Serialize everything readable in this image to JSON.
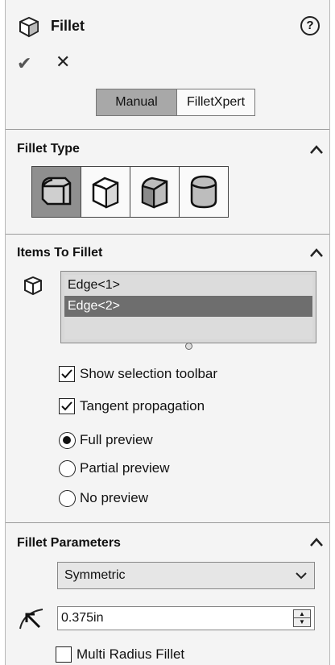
{
  "header": {
    "title": "Fillet",
    "help_icon": "help-icon"
  },
  "actions": {
    "ok_glyph": "✔",
    "cancel_glyph": "✕"
  },
  "modes": {
    "manual": "Manual",
    "filletxpert": "FilletXpert"
  },
  "fillet_type": {
    "heading": "Fillet Type",
    "buttons": [
      "constant-size-fillet-icon",
      "variable-size-fillet-icon",
      "face-fillet-icon",
      "full-round-fillet-icon"
    ],
    "selected_index": 0
  },
  "items": {
    "heading": "Items To Fillet",
    "list": [
      "Edge<1>",
      "Edge<2>"
    ],
    "selected_index": 1,
    "show_selection_toolbar": "Show selection toolbar",
    "tangent_propagation": "Tangent propagation",
    "full_preview": "Full preview",
    "partial_preview": "Partial preview",
    "no_preview": "No preview",
    "checked": {
      "show_selection_toolbar": true,
      "tangent_propagation": true
    },
    "preview_selected": "Full preview"
  },
  "parameters": {
    "heading": "Fillet Parameters",
    "profile_select": "Symmetric",
    "radius_value": "0.375in",
    "multi_radius": "Multi Radius Fillet"
  }
}
